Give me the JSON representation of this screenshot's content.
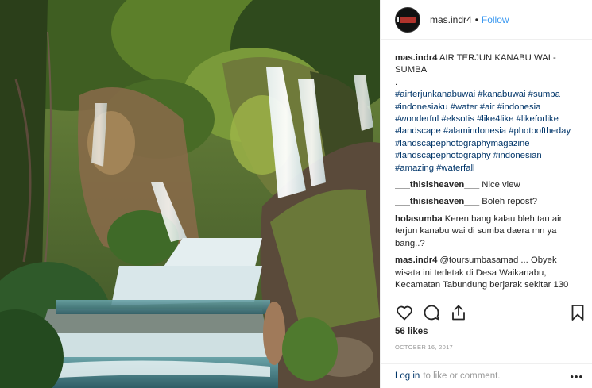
{
  "post": {
    "username": "mas.indr4",
    "follow_label": "Follow",
    "separator": "•"
  },
  "caption": {
    "username": "mas.indr4",
    "title": "AIR TERJUN KANABU WAI - SUMBA",
    "dot": ".",
    "hashtags": "#airterjunkanabuwai #kanabuwai #sumba #indonesiaku #water #air #indonesia #wonderful #eksotis #like4like #likeforlike #landscape #alamindonesia #photooftheday #landscapephotographymagazine #landscapephotography #indonesian #amazing #waterfall"
  },
  "comments": [
    {
      "username": "___thisisheaven___",
      "text": "Nice view"
    },
    {
      "username": "___thisisheaven___",
      "text": "Boleh repost?"
    },
    {
      "username": "holasumba",
      "text": "Keren bang kalau bleh tau air terjun kanabu wai di sumba daera mn ya bang..?"
    },
    {
      "username": "mas.indr4",
      "text": "@toursumbasamad ... Obyek wisata ini terletak di Desa Waikanabu, Kecamatan Tabundung berjarak sekitar 130"
    }
  ],
  "actions": {
    "like_icon": "heart-icon",
    "comment_icon": "comment-icon",
    "share_icon": "share-icon",
    "save_icon": "bookmark-icon"
  },
  "likes": "56 likes",
  "date": "OCTOBER 16, 2017",
  "footer": {
    "login": "Log in",
    "rest": "to like or comment.",
    "more": "•••"
  },
  "colors": {
    "link": "#003569",
    "follow": "#3897f0",
    "muted": "#999999",
    "text": "#262626"
  }
}
